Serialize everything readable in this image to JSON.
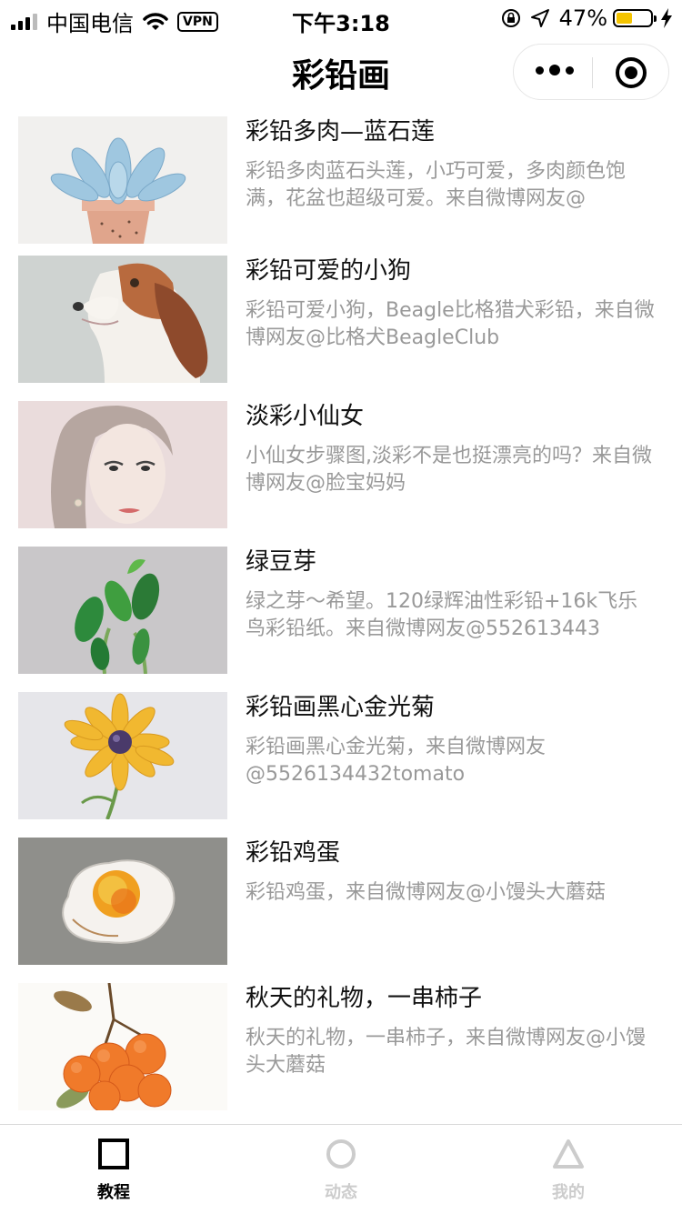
{
  "status_bar": {
    "carrier": "中国电信",
    "vpn": "VPN",
    "time": "下午3:18",
    "battery": "47%",
    "battery_level": 0.47,
    "icons": [
      "signal-icon",
      "wifi-icon",
      "rotation-lock-icon",
      "location-icon",
      "battery-icon",
      "charging-icon"
    ]
  },
  "nav": {
    "title": "彩铅画",
    "icons": [
      "more-icon",
      "close-mini-program-icon"
    ]
  },
  "items": [
    {
      "title": "彩铅多肉—蓝石莲",
      "desc": "彩铅多肉蓝石头莲，小巧可爱，多肉颜色饱满，花盆也超级可爱。来自微博网友@"
    },
    {
      "title": "彩铅可爱的小狗",
      "desc": "彩铅可爱小狗，Beagle比格猎犬彩铅，来自微博网友@比格犬BeagleClub"
    },
    {
      "title": "淡彩小仙女",
      "desc": "小仙女步骤图,淡彩不是也挺漂亮的吗？来自微博网友@脸宝妈妈"
    },
    {
      "title": "绿豆芽",
      "desc": "绿之芽～希望。120绿辉油性彩铅+16k飞乐鸟彩铅纸。来自微博网友@552613443"
    },
    {
      "title": "彩铅画黑心金光菊",
      "desc": "彩铅画黑心金光菊，来自微博网友@5526134432tomato"
    },
    {
      "title": "彩铅鸡蛋",
      "desc": "彩铅鸡蛋，来自微博网友@小馒头大蘑菇"
    },
    {
      "title": "秋天的礼物，一串柿子",
      "desc": "秋天的礼物，一串柿子，来自微博网友@小馒头大蘑菇"
    }
  ],
  "tabs": [
    {
      "label": "教程",
      "icon": "square-icon",
      "active": true,
      "color": "#000000"
    },
    {
      "label": "动态",
      "icon": "circle-icon",
      "active": false,
      "color": "#cccccc"
    },
    {
      "label": "我的",
      "icon": "triangle-icon",
      "active": false,
      "color": "#cccccc"
    }
  ],
  "colors": {
    "battery_fill": "#f4c400",
    "desc_text": "#999999",
    "tab_active": "#000000",
    "tab_inactive": "#cccccc"
  }
}
